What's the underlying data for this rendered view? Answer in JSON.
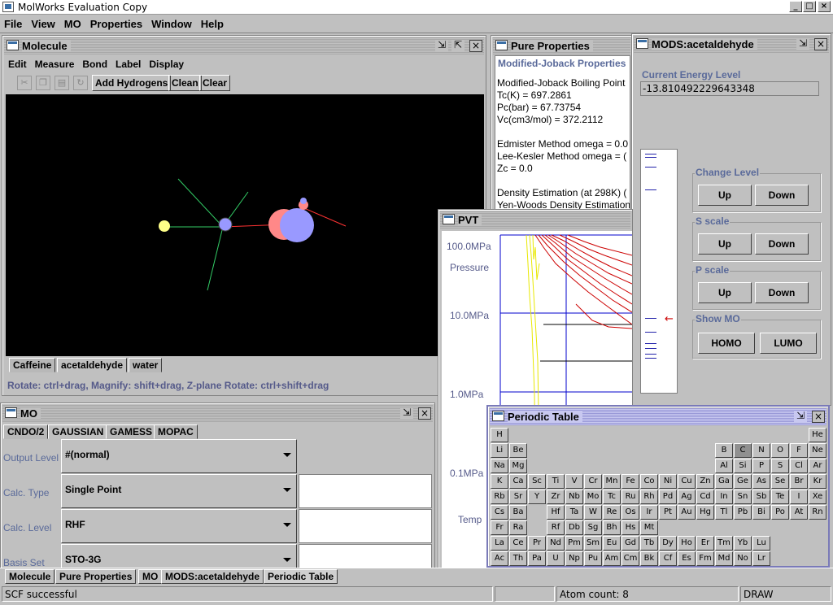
{
  "app": {
    "title": "MolWorks Evaluation Copy",
    "controls": [
      "_",
      "□",
      "×"
    ]
  },
  "menubar": [
    "File",
    "View",
    "MO",
    "Properties",
    "Window",
    "Help"
  ],
  "molecule": {
    "title": "Molecule",
    "menu": [
      "Edit",
      "Measure",
      "Bond",
      "Label",
      "Display"
    ],
    "toolbar": {
      "add_hydrogens": "Add Hydrogens",
      "clean": "Clean",
      "clear": "Clear"
    },
    "tabs": [
      "Caffeine",
      "acetaldehyde",
      "water"
    ],
    "active_tab": 1,
    "hint": "Rotate: ctrl+drag, Magnify: shift+drag, Z-plane Rotate: ctrl+shift+drag"
  },
  "pure_properties": {
    "title": "Pure Properties",
    "section": "Modified-Joback Properties",
    "lines": [
      "Modified-Joback Boiling Point",
      "Tc(K) = 697.2861",
      "Pc(bar) = 67.73754",
      "Vc(cm3/mol) = 372.2112",
      "",
      "Edmister Method omega = 0.0",
      "Lee-Kesler Method omega = (",
      "Zc = 0.0",
      "",
      "Density Estimation (at 298K) (",
      "Yen-Woods Density Estimation"
    ]
  },
  "mods": {
    "title": "MODS:acetaldehyde",
    "energy_label": "Current Energy Level",
    "energy_value": "-13.810492229643348",
    "change_level": {
      "label": "Change Level",
      "up": "Up",
      "down": "Down"
    },
    "s_scale": {
      "label": "S scale",
      "up": "Up",
      "down": "Down"
    },
    "p_scale": {
      "label": "P scale",
      "up": "Up",
      "down": "Down"
    },
    "show_mo": {
      "label": "Show MO",
      "homo": "HOMO",
      "lumo": "LUMO"
    },
    "arrow_glyph": "←"
  },
  "pvt": {
    "title": "PVT",
    "y_axis_title": "Pressure",
    "y_ticks": [
      "100.0MPa",
      "10.0MPa",
      "1.0MPa",
      "0.1MPa"
    ],
    "x_axis_title": "Temp"
  },
  "mo": {
    "title": "MO",
    "tabs": [
      "CNDO/2",
      "GAUSSIAN",
      "GAMESS",
      "MOPAC"
    ],
    "active_tab": 1,
    "rows": [
      {
        "label": "Output Level",
        "value": "#(normal)"
      },
      {
        "label": "Calc. Type",
        "value": "Single Point"
      },
      {
        "label": "Calc. Level",
        "value": "RHF"
      },
      {
        "label": "Basis Set",
        "value": "STO-3G"
      }
    ]
  },
  "periodic": {
    "title": "Periodic Table",
    "selected": "C",
    "rows": [
      [
        "H",
        "",
        "",
        "",
        "",
        "",
        "",
        "",
        "",
        "",
        "",
        "",
        "",
        "",
        "",
        "",
        "",
        "He"
      ],
      [
        "Li",
        "Be",
        "",
        "",
        "",
        "",
        "",
        "",
        "",
        "",
        "",
        "",
        "B",
        "C",
        "N",
        "O",
        "F",
        "Ne"
      ],
      [
        "Na",
        "Mg",
        "",
        "",
        "",
        "",
        "",
        "",
        "",
        "",
        "",
        "",
        "Al",
        "Si",
        "P",
        "S",
        "Cl",
        "Ar"
      ],
      [
        "K",
        "Ca",
        "Sc",
        "Ti",
        "V",
        "Cr",
        "Mn",
        "Fe",
        "Co",
        "Ni",
        "Cu",
        "Zn",
        "Ga",
        "Ge",
        "As",
        "Se",
        "Br",
        "Kr"
      ],
      [
        "Rb",
        "Sr",
        "Y",
        "Zr",
        "Nb",
        "Mo",
        "Tc",
        "Ru",
        "Rh",
        "Pd",
        "Ag",
        "Cd",
        "In",
        "Sn",
        "Sb",
        "Te",
        "I",
        "Xe"
      ],
      [
        "Cs",
        "Ba",
        "",
        "Hf",
        "Ta",
        "W",
        "Re",
        "Os",
        "Ir",
        "Pt",
        "Au",
        "Hg",
        "Tl",
        "Pb",
        "Bi",
        "Po",
        "At",
        "Rn"
      ],
      [
        "Fr",
        "Ra",
        "",
        "Rf",
        "Db",
        "Sg",
        "Bh",
        "Hs",
        "Mt",
        "",
        "",
        "",
        "",
        "",
        "",
        "",
        "",
        ""
      ],
      [
        "La",
        "Ce",
        "Pr",
        "Nd",
        "Pm",
        "Sm",
        "Eu",
        "Gd",
        "Tb",
        "Dy",
        "Ho",
        "Er",
        "Tm",
        "Yb",
        "Lu",
        "",
        "",
        ""
      ],
      [
        "Ac",
        "Th",
        "Pa",
        "U",
        "Np",
        "Pu",
        "Am",
        "Cm",
        "Bk",
        "Cf",
        "Es",
        "Fm",
        "Md",
        "No",
        "Lr",
        "",
        "",
        ""
      ]
    ]
  },
  "taskbar": [
    "Molecule",
    "Pure Properties",
    "MO",
    "MODS:acetaldehyde",
    "Periodic Table"
  ],
  "taskbar_active": 4,
  "status": {
    "message": "SCF successful",
    "atom_count": "Atom count: 8",
    "mode": "DRAW"
  },
  "colors": {
    "desktop": "#c0c0c0",
    "label_blue": "#5a6a9a",
    "viewer_bg": "#000000",
    "pvt_curve": "#cc0000",
    "pvt_yellow": "#e8e800",
    "pvt_axis": "#0000cc"
  }
}
